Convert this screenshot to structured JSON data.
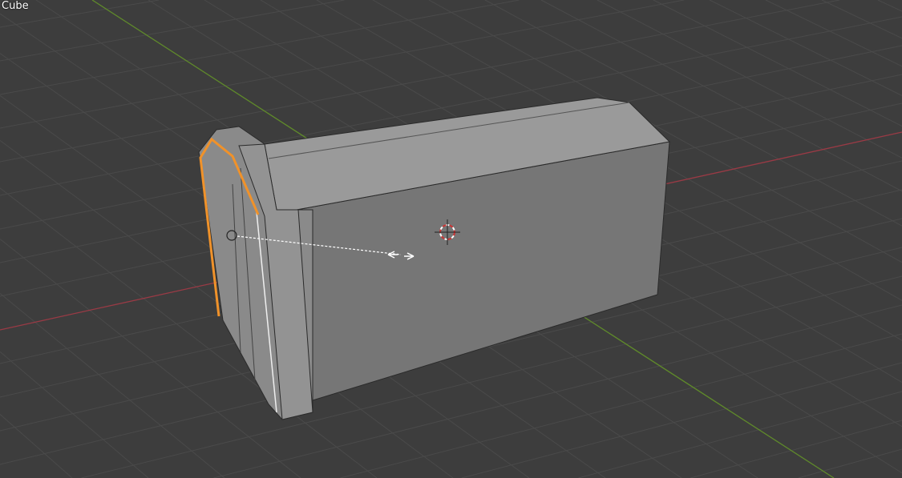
{
  "viewport": {
    "object_name": "Cube",
    "colors": {
      "background": "#3d3d3d",
      "grid": "#4a4a4a",
      "x_axis": "#9a3a45",
      "y_axis": "#5f8a2a",
      "selected_edge": "#f0922a"
    }
  }
}
